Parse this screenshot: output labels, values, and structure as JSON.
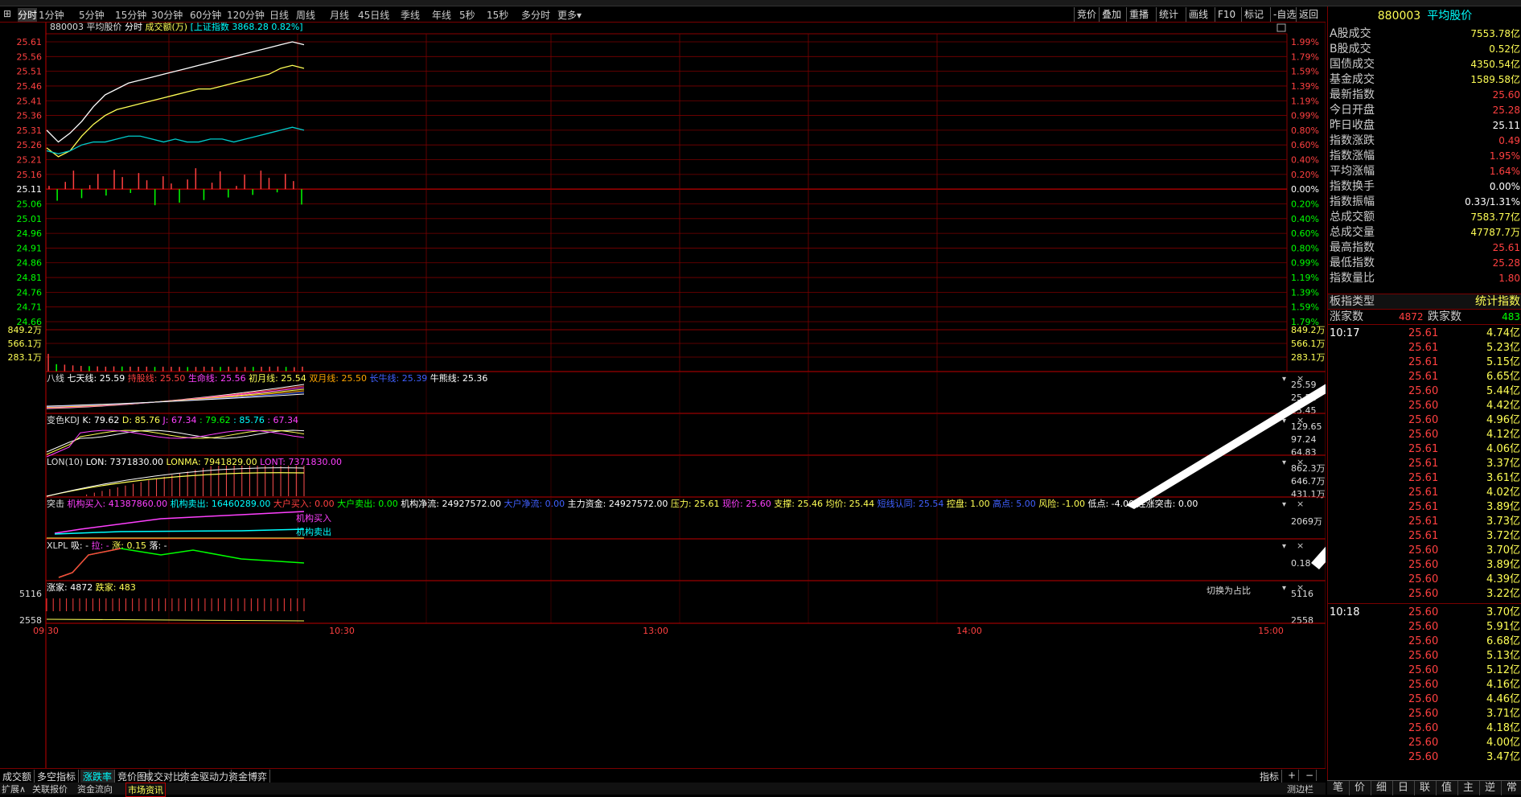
{
  "periods": [
    {
      "label": "分时",
      "active": true
    },
    {
      "label": "1分钟"
    },
    {
      "label": "5分钟"
    },
    {
      "label": "15分钟"
    },
    {
      "label": "30分钟"
    },
    {
      "label": "60分钟"
    },
    {
      "label": "120分钟"
    },
    {
      "label": "日线"
    },
    {
      "label": "周线"
    },
    {
      "label": "月线"
    },
    {
      "label": "45日线"
    },
    {
      "label": "季线"
    },
    {
      "label": "年线"
    },
    {
      "label": "5秒"
    },
    {
      "label": "15秒"
    },
    {
      "label": "多分时"
    },
    {
      "label": "更多▾"
    }
  ],
  "right_toolbar": [
    "竞价",
    "叠加",
    "重播",
    "统计",
    "画线",
    "F10",
    "标记",
    "-自选",
    "返回"
  ],
  "chart_header": {
    "code_name": "880003 平均股价",
    "mode": "分时",
    "volume_label": "成交额(万)",
    "compare": "[上证指数 3868.28 0.82%]"
  },
  "main_y_left": [
    "25.61",
    "25.56",
    "25.51",
    "25.46",
    "25.41",
    "25.36",
    "25.31",
    "25.26",
    "25.21",
    "25.16",
    "25.11",
    "25.06",
    "25.01",
    "24.96",
    "24.91",
    "24.86",
    "24.81",
    "24.76",
    "24.71",
    "24.66"
  ],
  "main_y_right": [
    "1.99%",
    "1.79%",
    "1.59%",
    "1.39%",
    "1.19%",
    "0.99%",
    "0.80%",
    "0.60%",
    "0.40%",
    "0.20%",
    "0.00%",
    "0.20%",
    "0.40%",
    "0.60%",
    "0.80%",
    "0.99%",
    "1.19%",
    "1.39%",
    "1.59%",
    "1.79%"
  ],
  "vol_y": [
    "849.2万",
    "566.1万",
    "283.1万"
  ],
  "time_axis": [
    "09:30",
    "10:30",
    "13:00",
    "14:00",
    "15:00"
  ],
  "indicators": {
    "bx": {
      "name": "八线",
      "items": [
        {
          "t": "七天线: 25.59",
          "c": "#ffffff"
        },
        {
          "t": "持股线: 25.50",
          "c": "#ff4040"
        },
        {
          "t": "生命线: 25.56",
          "c": "#ff40ff"
        },
        {
          "t": "初月线: 25.54",
          "c": "#ffff55"
        },
        {
          "t": "双月线: 25.50",
          "c": "#ffa500"
        },
        {
          "t": "长牛线: 25.39",
          "c": "#4060ff"
        },
        {
          "t": "牛熊线: 25.36",
          "c": "#ffffff"
        }
      ],
      "y": [
        "25.59",
        "25.52",
        "25.45"
      ]
    },
    "kdj": {
      "name": "变色KDJ",
      "items": [
        {
          "t": "K: 79.62",
          "c": "#ffffff"
        },
        {
          "t": "D: 85.76",
          "c": "#ffff55"
        },
        {
          "t": "J: 67.34",
          "c": "#ff40ff"
        },
        {
          "t": ": 79.62",
          "c": "#00ff00"
        },
        {
          "t": ": 85.76",
          "c": "#00ffff"
        },
        {
          "t": ": 67.34",
          "c": "#ff40ff"
        }
      ],
      "y": [
        "129.65",
        "97.24",
        "64.83"
      ]
    },
    "lon": {
      "name": "LON(10)",
      "items": [
        {
          "t": "LON: 7371830.00",
          "c": "#ffffff"
        },
        {
          "t": "LONMA: 7941829.00",
          "c": "#ffff55"
        },
        {
          "t": "LONT: 7371830.00",
          "c": "#ff40ff"
        }
      ],
      "y": [
        "862.3万",
        "646.7万",
        "431.1万"
      ]
    },
    "tj": {
      "name": "突击",
      "items": [
        {
          "t": "机构买入: 41387860.00",
          "c": "#ff40ff"
        },
        {
          "t": "机构卖出: 16460289.00",
          "c": "#00ffff"
        },
        {
          "t": "大户买入: 0.00",
          "c": "#ff4040"
        },
        {
          "t": "大户卖出: 0.00",
          "c": "#00ff00"
        },
        {
          "t": "机构净流: 24927572.00",
          "c": "#ffffff"
        },
        {
          "t": "大户净流: 0.00",
          "c": "#4060ff"
        },
        {
          "t": "主力资金: 24927572.00",
          "c": "#ffffff"
        },
        {
          "t": "压力: 25.61",
          "c": "#ffff55"
        },
        {
          "t": "现价: 25.60",
          "c": "#ff40ff"
        },
        {
          "t": "支撑: 25.46",
          "c": "#ffff55"
        },
        {
          "t": "均价: 25.44",
          "c": "#ffff55"
        },
        {
          "t": "短线认同: 25.54",
          "c": "#4060ff"
        },
        {
          "t": "控盘: 1.00",
          "c": "#ffff55"
        },
        {
          "t": "高点: 5.00",
          "c": "#4060ff"
        },
        {
          "t": "风险: -1.00",
          "c": "#ffff55"
        },
        {
          "t": "低点: -4.00",
          "c": "#ffffff"
        },
        {
          "t": "连涨突击: 0.00",
          "c": "#ffffff"
        }
      ],
      "label_buy": "机构买入",
      "label_sell": "机构卖出",
      "y": [
        "2069万"
      ]
    },
    "xlpl": {
      "name": "XLPL",
      "items": [
        {
          "t": "吸: -",
          "c": "#ffffff"
        },
        {
          "t": "拉: -",
          "c": "#ff40ff"
        },
        {
          "t": "涨: 0.15",
          "c": "#ffff55"
        },
        {
          "t": "落: -",
          "c": "#ffffff"
        }
      ],
      "y": [
        "0.18"
      ]
    },
    "zd": {
      "items": [
        {
          "t": "涨家: 4872",
          "c": "#ffffff"
        },
        {
          "t": "跌家: 483",
          "c": "#ffff55"
        }
      ],
      "switch": "切换为占比",
      "y": [
        "5116",
        "2558"
      ]
    }
  },
  "bottom_tabs": [
    "成交额",
    "多空指标",
    "涨跌率",
    "竞价图",
    "成交对比",
    "资金驱动力",
    "资金博弈"
  ],
  "bottom_right": [
    "指标",
    "+",
    "−"
  ],
  "status_items": [
    "扩展∧",
    "关联报价",
    "资金流向",
    "市场资讯",
    "测边栏"
  ],
  "right_panel": {
    "title_code": "880003",
    "title_name": "平均股价",
    "rows": [
      {
        "l": "A股成交",
        "v": "7553.78亿",
        "c": "#ffff55"
      },
      {
        "l": "B股成交",
        "v": "0.52亿",
        "c": "#ffff55"
      },
      {
        "l": "国债成交",
        "v": "4350.54亿",
        "c": "#ffff55"
      },
      {
        "l": "基金成交",
        "v": "1589.58亿",
        "c": "#ffff55"
      },
      {
        "l": "最新指数",
        "v": "25.60",
        "c": "#ff4040"
      },
      {
        "l": "今日开盘",
        "v": "25.28",
        "c": "#ff4040"
      },
      {
        "l": "昨日收盘",
        "v": "25.11",
        "c": "#ffffff"
      },
      {
        "l": "指数涨跌",
        "v": "0.49",
        "c": "#ff4040"
      },
      {
        "l": "指数涨幅",
        "v": "1.95%",
        "c": "#ff4040"
      },
      {
        "l": "平均涨幅",
        "v": "1.64%",
        "c": "#ff4040"
      },
      {
        "l": "指数换手",
        "v": "0.00%",
        "c": "#ffffff"
      },
      {
        "l": "指数振幅",
        "v": "0.33/1.31%",
        "c": "#ffffff"
      },
      {
        "l": "总成交额",
        "v": "7583.77亿",
        "c": "#ffff55"
      },
      {
        "l": "总成交量",
        "v": "47787.7万",
        "c": "#ffff55"
      },
      {
        "l": "最高指数",
        "v": "25.61",
        "c": "#ff4040"
      },
      {
        "l": "最低指数",
        "v": "25.28",
        "c": "#ff4040"
      },
      {
        "l": "指数量比",
        "v": "1.80",
        "c": "#ff4040"
      }
    ],
    "type_label": "板指类型",
    "type_value": "统计指数",
    "up_label": "涨家数",
    "up_value": "4872",
    "down_label": "跌家数",
    "down_value": "483",
    "ticks1": [
      {
        "t": "10:17",
        "p": "25.61",
        "v": "4.74亿"
      },
      {
        "t": "",
        "p": "25.61",
        "v": "5.23亿"
      },
      {
        "t": "",
        "p": "25.61",
        "v": "5.15亿"
      },
      {
        "t": "",
        "p": "25.61",
        "v": "6.65亿"
      },
      {
        "t": "",
        "p": "25.60",
        "v": "5.44亿"
      },
      {
        "t": "",
        "p": "25.60",
        "v": "4.42亿"
      },
      {
        "t": "",
        "p": "25.60",
        "v": "4.96亿"
      },
      {
        "t": "",
        "p": "25.60",
        "v": "4.12亿"
      },
      {
        "t": "",
        "p": "25.61",
        "v": "4.06亿"
      },
      {
        "t": "",
        "p": "25.61",
        "v": "3.37亿"
      },
      {
        "t": "",
        "p": "25.61",
        "v": "3.61亿"
      },
      {
        "t": "",
        "p": "25.61",
        "v": "4.02亿"
      },
      {
        "t": "",
        "p": "25.61",
        "v": "3.89亿"
      },
      {
        "t": "",
        "p": "25.61",
        "v": "3.73亿"
      },
      {
        "t": "",
        "p": "25.61",
        "v": "3.72亿"
      },
      {
        "t": "",
        "p": "25.60",
        "v": "3.70亿"
      },
      {
        "t": "",
        "p": "25.60",
        "v": "3.89亿"
      },
      {
        "t": "",
        "p": "25.60",
        "v": "4.39亿"
      },
      {
        "t": "",
        "p": "25.60",
        "v": "3.22亿"
      }
    ],
    "ticks2": [
      {
        "t": "10:18",
        "p": "25.60",
        "v": "3.70亿"
      },
      {
        "t": "",
        "p": "25.60",
        "v": "5.91亿"
      },
      {
        "t": "",
        "p": "25.60",
        "v": "6.68亿"
      },
      {
        "t": "",
        "p": "25.60",
        "v": "5.13亿"
      },
      {
        "t": "",
        "p": "25.60",
        "v": "5.12亿"
      },
      {
        "t": "",
        "p": "25.60",
        "v": "4.16亿"
      },
      {
        "t": "",
        "p": "25.60",
        "v": "4.46亿"
      },
      {
        "t": "",
        "p": "25.60",
        "v": "3.71亿"
      },
      {
        "t": "",
        "p": "25.60",
        "v": "4.18亿"
      },
      {
        "t": "",
        "p": "25.60",
        "v": "4.00亿"
      },
      {
        "t": "",
        "p": "25.60",
        "v": "3.47亿"
      }
    ],
    "tabs": [
      "笔",
      "价",
      "细",
      "日",
      "联",
      "值",
      "主",
      "逆",
      "常"
    ]
  },
  "chart_data": {
    "type": "line",
    "ylim": [
      24.66,
      25.61
    ],
    "x_ticks": [
      "09:30",
      "10:30",
      "13:00",
      "14:00",
      "15:00"
    ],
    "series": [
      {
        "values": [
          25.31,
          25.27,
          25.3,
          25.34,
          25.39,
          25.43,
          25.45,
          25.47,
          25.48,
          25.49,
          25.5,
          25.51,
          25.52,
          25.53,
          25.54,
          25.55,
          25.56,
          25.57,
          25.58,
          25.59,
          25.6,
          25.61,
          25.6
        ],
        "color": "#ffffff"
      },
      {
        "values": [
          25.25,
          25.22,
          25.24,
          25.29,
          25.33,
          25.36,
          25.38,
          25.39,
          25.4,
          25.41,
          25.42,
          25.43,
          25.44,
          25.45,
          25.45,
          25.46,
          25.47,
          25.48,
          25.49,
          25.5,
          25.52,
          25.53,
          25.52
        ],
        "color": "#ffff55"
      },
      {
        "values": [
          25.24,
          25.23,
          25.24,
          25.26,
          25.27,
          25.27,
          25.28,
          25.29,
          25.29,
          25.28,
          25.27,
          25.28,
          25.27,
          25.27,
          25.28,
          25.28,
          25.27,
          25.28,
          25.29,
          25.3,
          25.31,
          25.32,
          25.31
        ],
        "color": "#00cccc"
      }
    ],
    "volume_values": [
      720,
      300,
      280,
      250,
      230,
      220,
      210,
      200,
      210,
      205,
      200,
      195,
      200,
      190,
      200,
      195,
      190,
      185,
      190,
      200,
      195,
      190,
      200,
      185,
      190,
      190,
      195,
      200,
      205,
      190,
      180,
      200
    ]
  }
}
